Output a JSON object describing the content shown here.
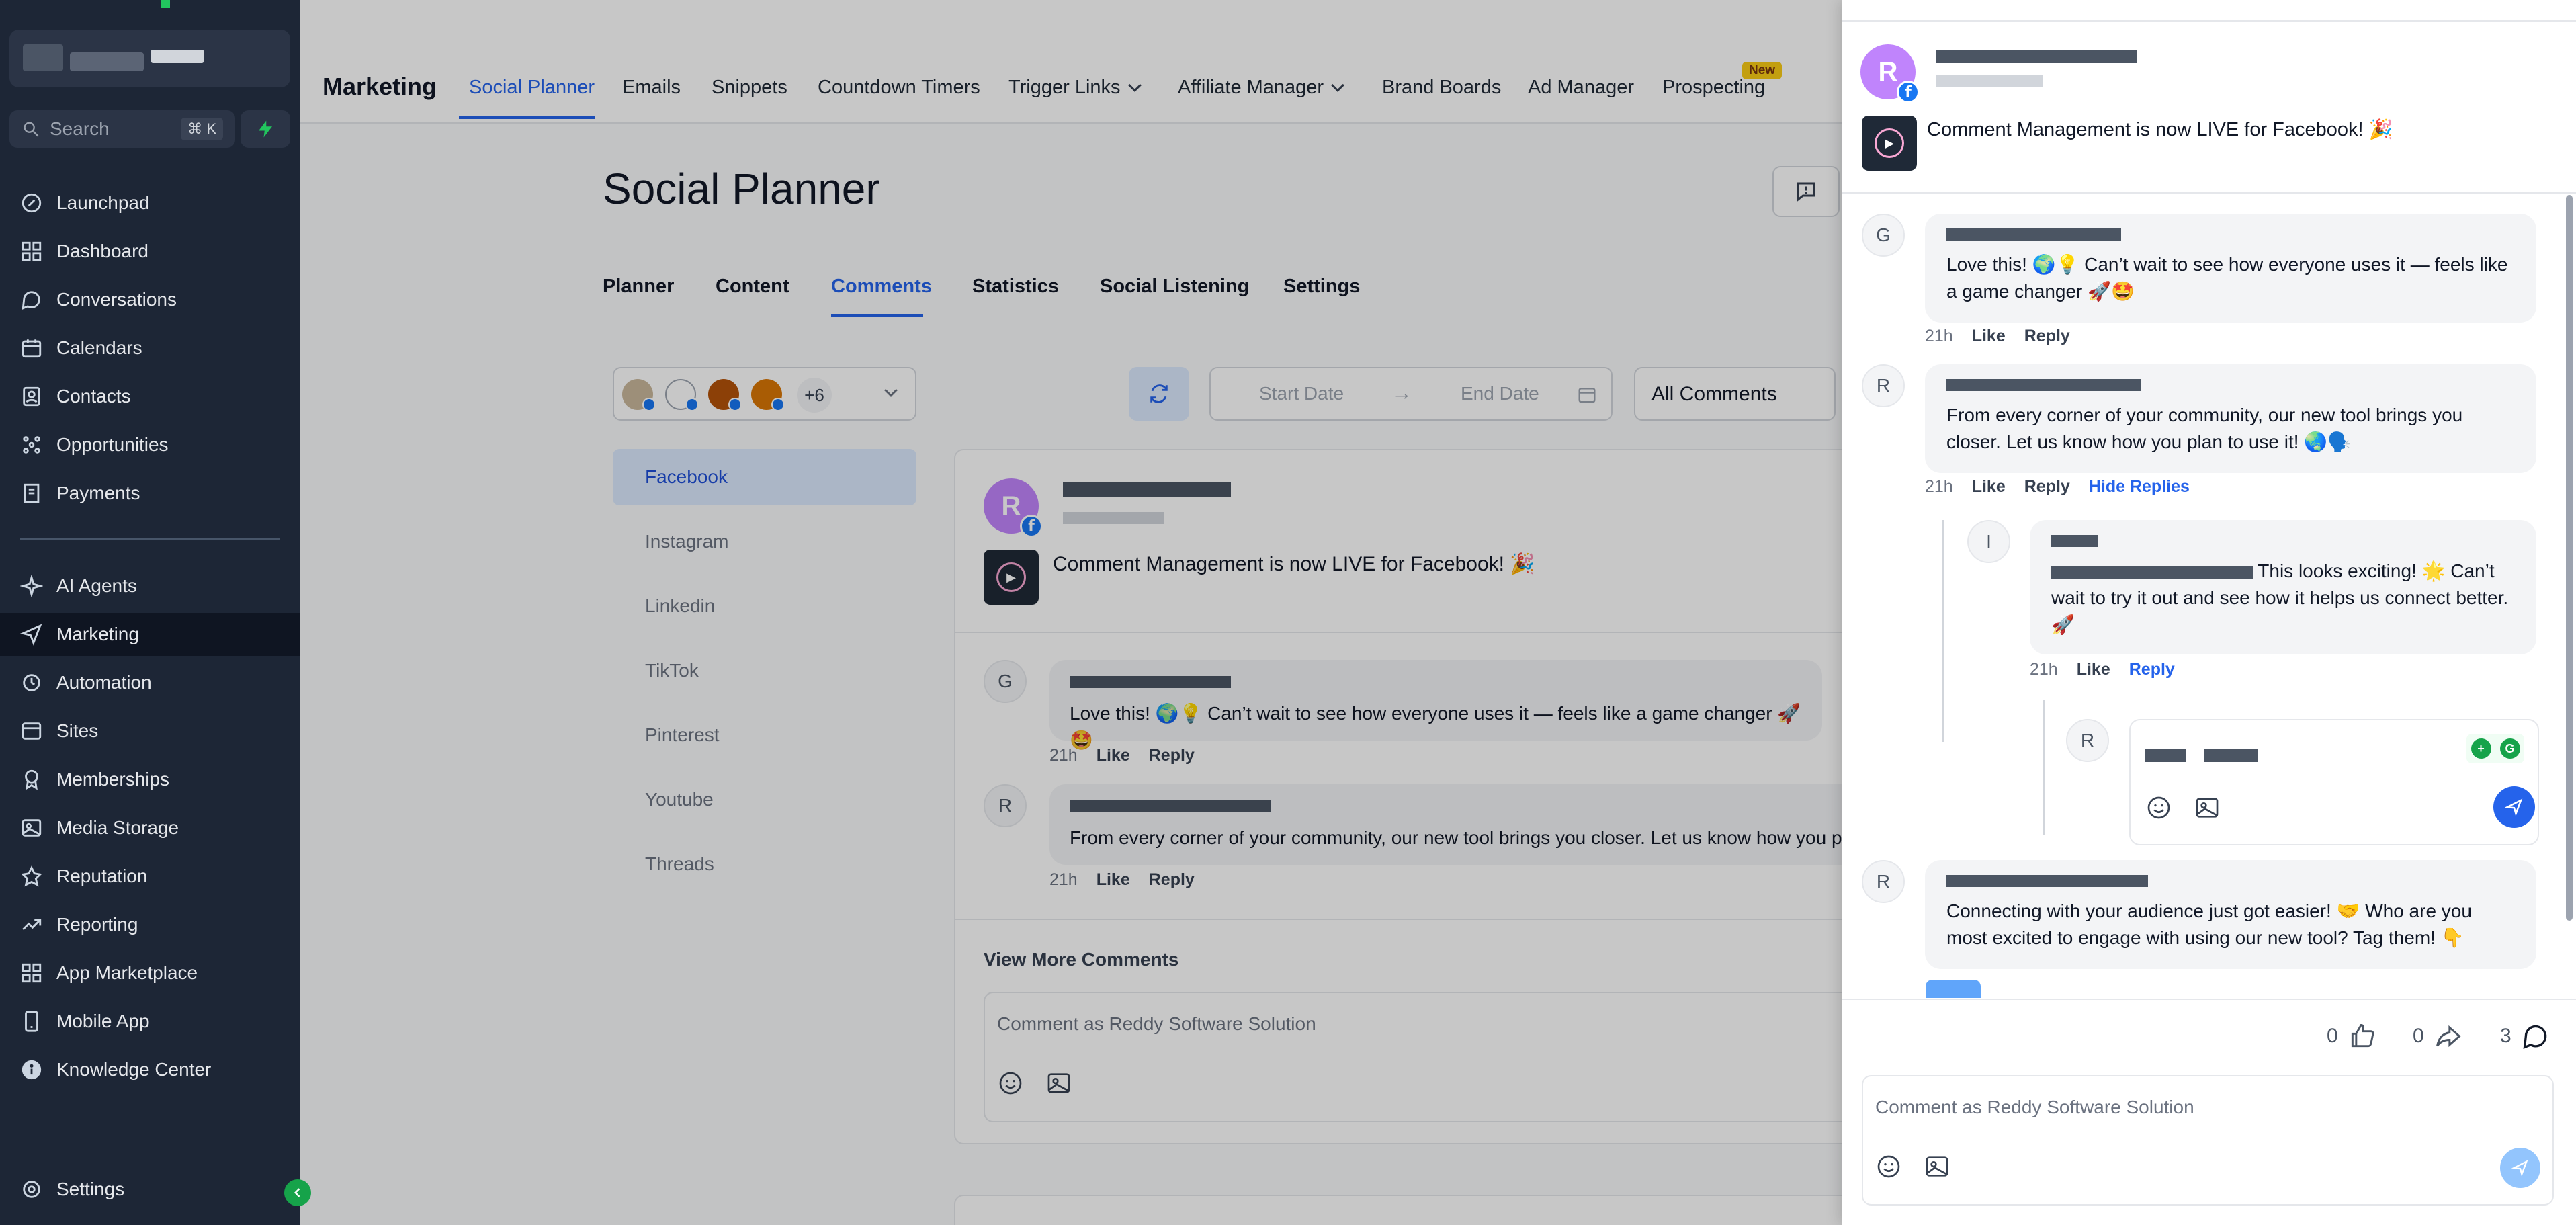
{
  "colors": {
    "sidebar_bg": "#1d2636",
    "accent": "#2563eb",
    "avatar_purple": "#c084fc",
    "facebook_blue": "#1877f2"
  },
  "sidebar": {
    "search_placeholder": "Search",
    "search_shortcut": "⌘ K",
    "items": [
      {
        "label": "Launchpad",
        "icon": "launchpad-icon"
      },
      {
        "label": "Dashboard",
        "icon": "dashboard-icon"
      },
      {
        "label": "Conversations",
        "icon": "chat-icon"
      },
      {
        "label": "Calendars",
        "icon": "calendar-icon"
      },
      {
        "label": "Contacts",
        "icon": "contacts-icon"
      },
      {
        "label": "Opportunities",
        "icon": "opportunities-icon"
      },
      {
        "label": "Payments",
        "icon": "payments-icon"
      },
      {
        "label": "AI Agents",
        "icon": "sparkle-icon"
      },
      {
        "label": "Marketing",
        "icon": "send-icon"
      },
      {
        "label": "Automation",
        "icon": "automation-icon"
      },
      {
        "label": "Sites",
        "icon": "sites-icon"
      },
      {
        "label": "Memberships",
        "icon": "memberships-icon"
      },
      {
        "label": "Media Storage",
        "icon": "image-icon"
      },
      {
        "label": "Reputation",
        "icon": "star-icon"
      },
      {
        "label": "Reporting",
        "icon": "trend-icon"
      },
      {
        "label": "App Marketplace",
        "icon": "grid-icon"
      },
      {
        "label": "Mobile App",
        "icon": "mobile-icon"
      },
      {
        "label": "Knowledge Center",
        "icon": "info-icon"
      }
    ],
    "settings_label": "Settings"
  },
  "header": {
    "module_title": "Marketing",
    "tabs": [
      "Social Planner",
      "Emails",
      "Snippets",
      "Countdown Timers",
      "Trigger Links",
      "Affiliate Manager",
      "Brand Boards",
      "Ad Manager",
      "Prospecting"
    ],
    "new_badge": "New"
  },
  "page": {
    "title": "Social Planner",
    "subtabs": [
      "Planner",
      "Content",
      "Comments",
      "Statistics",
      "Social Listening",
      "Settings"
    ],
    "account_more": "+6",
    "start_date_placeholder": "Start Date",
    "end_date_placeholder": "End Date",
    "filter_value": "All Comments",
    "platforms": [
      "Facebook",
      "Instagram",
      "Linkedin",
      "TikTok",
      "Pinterest",
      "Youtube",
      "Threads"
    ]
  },
  "post": {
    "avatar_letter": "R",
    "caption": "Comment Management is now LIVE for Facebook! 🎉",
    "view_more": "View More Comments",
    "comment_placeholder": "Comment as Reddy Software Solution",
    "comments": [
      {
        "avatar": "G",
        "text": "Love this! 🌍💡 Can’t wait to see how everyone uses it — feels like a game changer 🚀🤩",
        "time": "21h",
        "like": "Like",
        "reply": "Reply"
      },
      {
        "avatar": "R",
        "text": "From every corner of your community, our new tool brings you closer. Let us know how you plan to use it! 🌏🗣️",
        "time": "21h",
        "like": "Like",
        "reply": "Reply"
      }
    ]
  },
  "drawer": {
    "avatar_letter": "R",
    "caption": "Comment Management is now LIVE for Facebook! 🎉",
    "comments": [
      {
        "avatar": "G",
        "text": "Love this! 🌍💡 Can’t wait to see how everyone uses it — feels like a game changer 🚀🤩",
        "time": "21h",
        "like": "Like",
        "reply": "Reply"
      },
      {
        "avatar": "R",
        "text": "From every corner of your community, our new tool brings you closer. Let us know how you plan to use it! 🌏🗣️",
        "time": "21h",
        "like": "Like",
        "reply": "Reply",
        "hide_replies": "Hide Replies"
      },
      {
        "avatar": "R",
        "text": "Connecting with your audience just got easier! 🤝 Who are you most excited to engage with using our new tool? Tag them! 👇"
      }
    ],
    "reply": {
      "avatar": "I",
      "text": "This looks exciting! 🌟 Can’t wait to try it out and see how it helps us connect better. 🚀",
      "time": "21h",
      "like": "Like",
      "reply": "Reply"
    },
    "reply_input_avatar": "R",
    "reactions": {
      "likes": "0",
      "shares": "0",
      "comments": "3"
    },
    "comment_placeholder": "Comment as Reddy Software Solution"
  }
}
